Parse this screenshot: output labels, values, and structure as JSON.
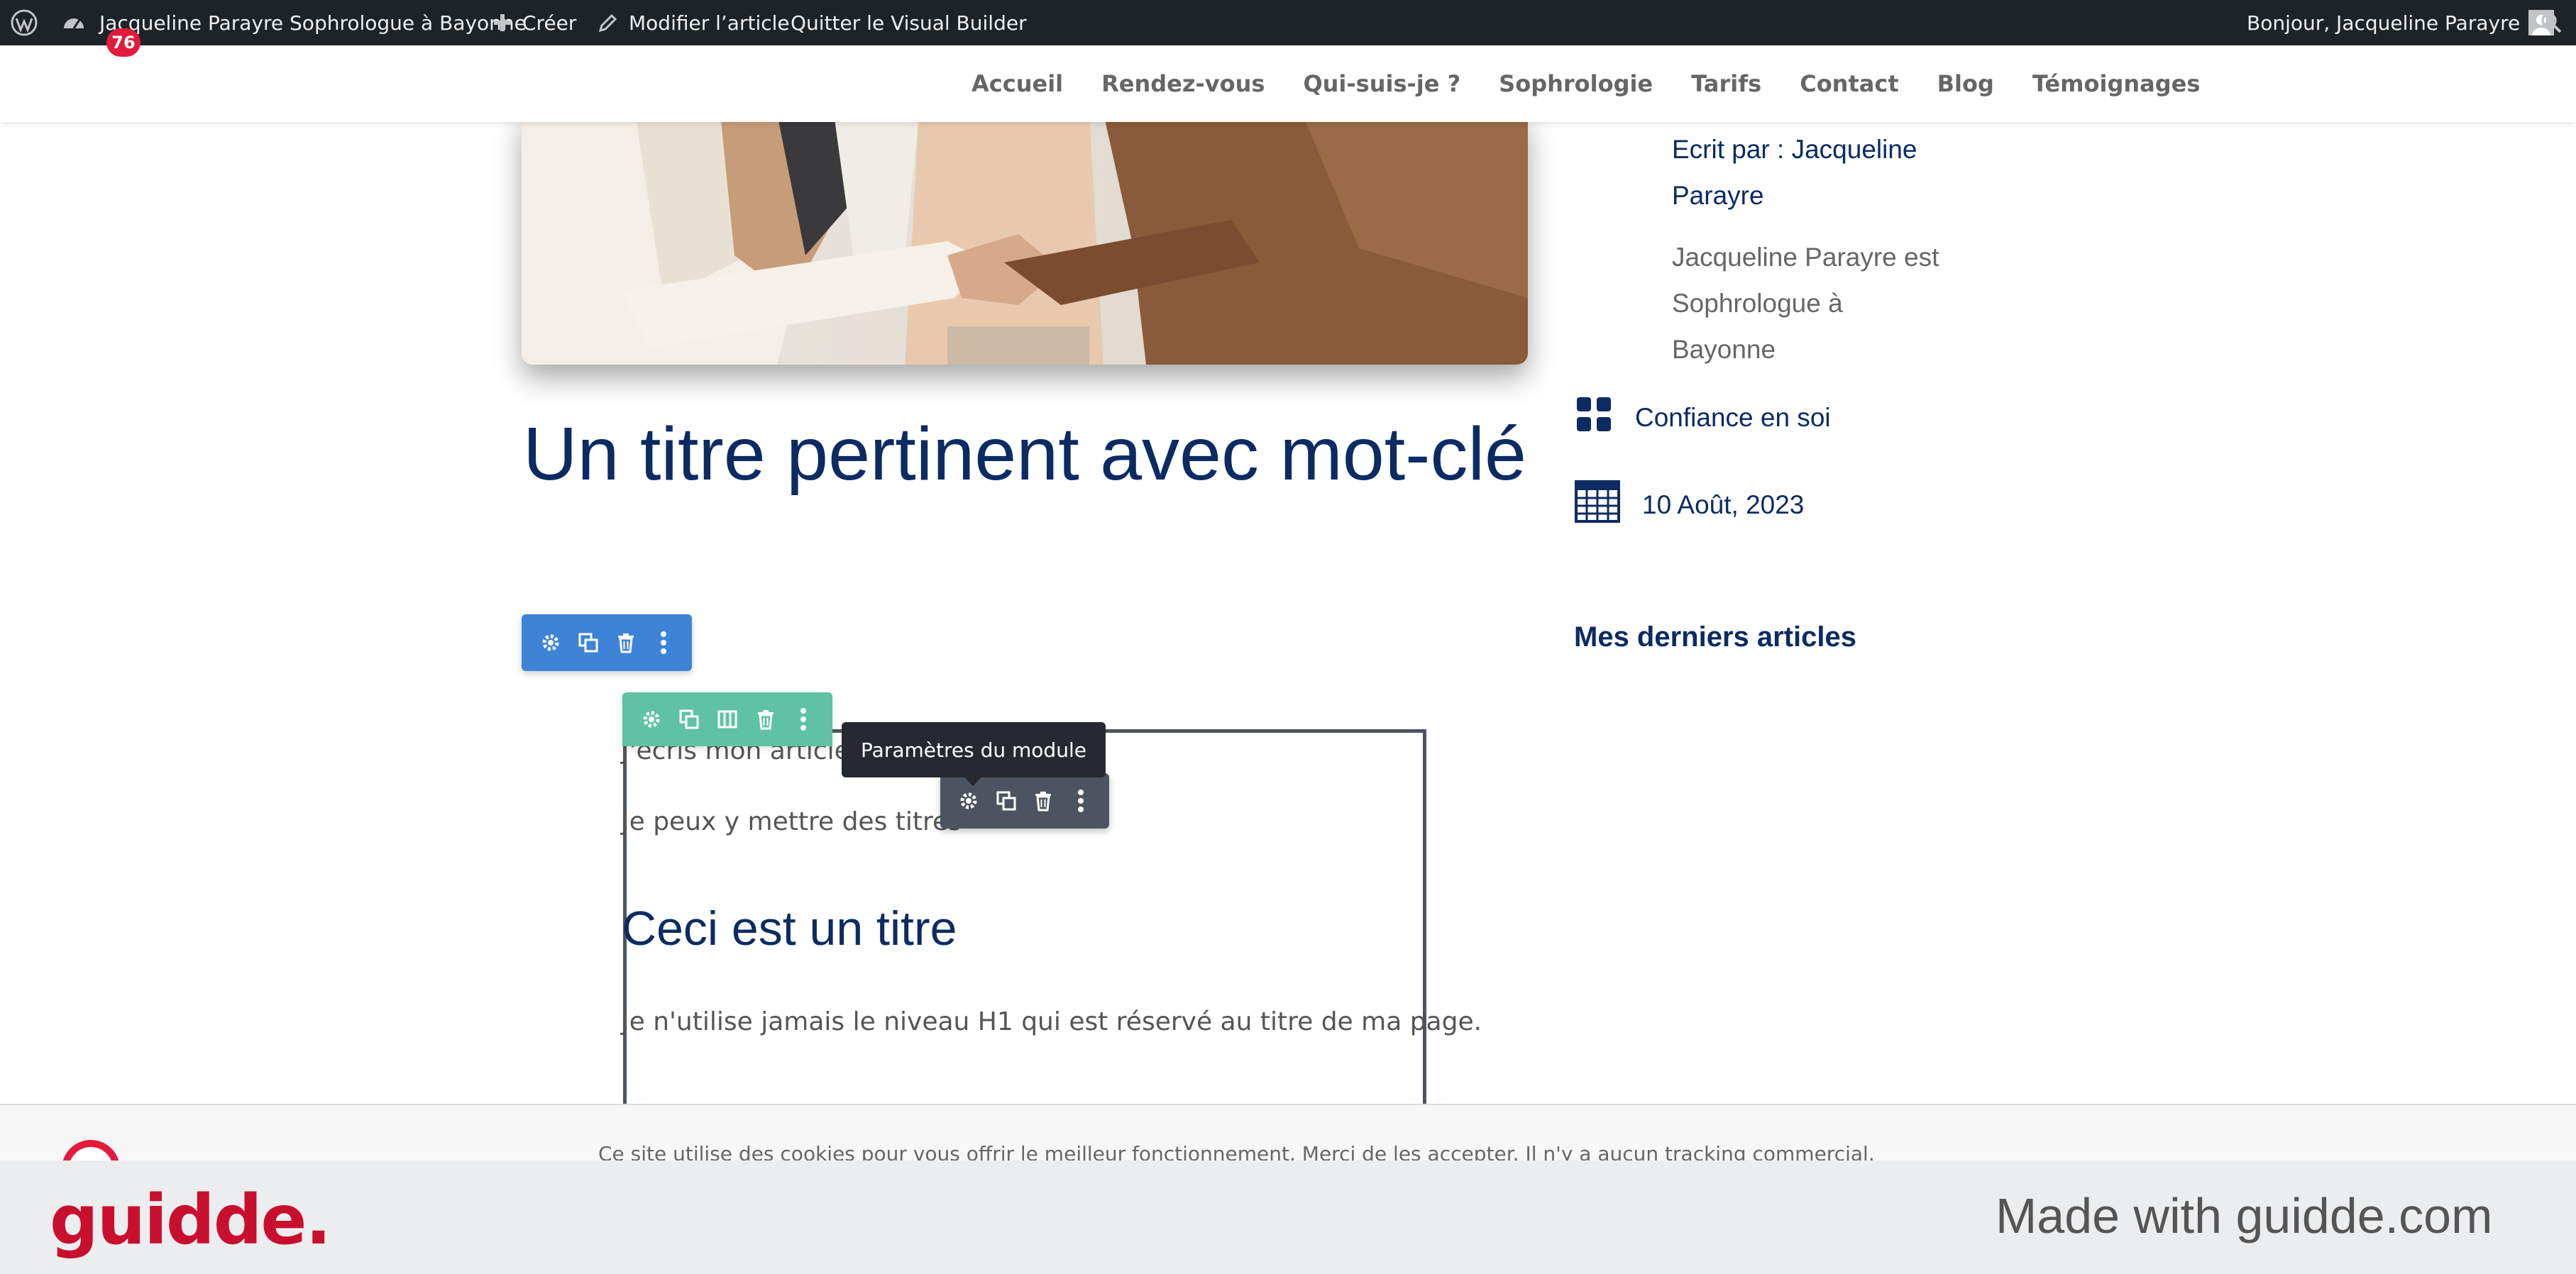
{
  "admin_bar": {
    "site_name": "Jacqueline Parayre Sophrologue à Bayonne",
    "create_label": "Créer",
    "edit_label": "Modifier l’article",
    "exit_label": "Quitter le Visual Builder",
    "greeting": "Bonjour, Jacqueline Parayre"
  },
  "nav": {
    "items": [
      "Accueil",
      "Rendez-vous",
      "Qui-suis-je ?",
      "Sophrologie",
      "Tarifs",
      "Contact",
      "Blog",
      "Témoignages"
    ]
  },
  "article": {
    "title": "Un titre pertinent avec mot-clé"
  },
  "sidebar": {
    "author_line1": "Ecrit par : Jacqueline",
    "author_line2": "Parayre",
    "bio_line1": "Jacqueline Parayre est",
    "bio_line2": "Sophrologue à",
    "bio_line3": "Bayonne",
    "category": "Confiance en soi",
    "date": "10 Août, 2023",
    "recent_heading": "Mes derniers articles"
  },
  "builder": {
    "tooltip": "Paramètres du module"
  },
  "content": {
    "p1": "J'écris mon article ici",
    "p2": "Je peux y mettre des titres",
    "h2": "Ceci est un titre",
    "p3": "Je n'utilise jamais le niveau H1 qui est réservé au titre de ma page."
  },
  "cookie": {
    "text": "Ce site utilise des cookies pour vous offrir le meilleur fonctionnement. Merci de les accepter. Il n'y a aucun tracking commercial.",
    "badge_count": "76"
  },
  "footer": {
    "logo": "guidde.",
    "made_with": "Made with guidde.com"
  },
  "colors": {
    "brand_navy": "#0c2b63",
    "section_blue": "#3e84d6",
    "row_green": "#5fc2a3",
    "module_grey": "#4d5461",
    "guidde_red": "#c8102e"
  },
  "icons": [
    "wordpress-icon",
    "dashboard-icon",
    "plus-icon",
    "pencil-icon",
    "avatar-icon",
    "search-icon",
    "category-grid-icon",
    "calendar-icon",
    "gear-icon",
    "duplicate-icon",
    "columns-icon",
    "trash-icon",
    "more-icon"
  ]
}
